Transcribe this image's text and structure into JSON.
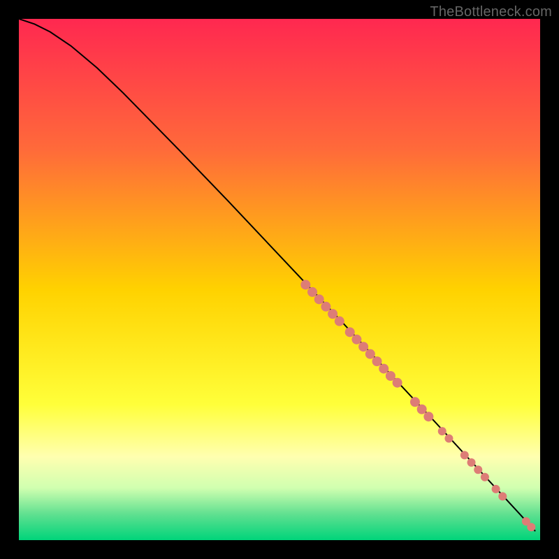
{
  "watermark": "TheBottleneck.com",
  "chart_data": {
    "type": "line",
    "title": "",
    "xlabel": "",
    "ylabel": "",
    "xlim": [
      0,
      100
    ],
    "ylim": [
      0,
      100
    ],
    "grid": false,
    "background_gradient": {
      "stops": [
        {
          "offset": 0,
          "color": "#ff2850"
        },
        {
          "offset": 25,
          "color": "#ff6a3a"
        },
        {
          "offset": 52,
          "color": "#ffd200"
        },
        {
          "offset": 74,
          "color": "#ffff3a"
        },
        {
          "offset": 84,
          "color": "#ffffb0"
        },
        {
          "offset": 90,
          "color": "#d0ffb0"
        },
        {
          "offset": 95,
          "color": "#60e090"
        },
        {
          "offset": 100,
          "color": "#00d47a"
        }
      ]
    },
    "series": [
      {
        "name": "curve",
        "type": "line",
        "color": "#000000",
        "x": [
          0,
          3,
          6,
          10,
          15,
          20,
          30,
          40,
          50,
          60,
          70,
          80,
          90,
          96,
          99
        ],
        "y": [
          100,
          99,
          97.5,
          94.8,
          90.6,
          85.8,
          75.6,
          65.2,
          54.6,
          44.0,
          33.2,
          22.5,
          11.6,
          5.1,
          1.8
        ]
      },
      {
        "name": "markers",
        "type": "scatter",
        "color": "#dd7d76",
        "points": [
          {
            "x": 55.0,
            "y": 49.0,
            "r": 7
          },
          {
            "x": 56.3,
            "y": 47.6,
            "r": 7
          },
          {
            "x": 57.6,
            "y": 46.2,
            "r": 7
          },
          {
            "x": 58.9,
            "y": 44.8,
            "r": 7
          },
          {
            "x": 60.2,
            "y": 43.4,
            "r": 7
          },
          {
            "x": 61.5,
            "y": 42.0,
            "r": 7
          },
          {
            "x": 63.5,
            "y": 39.9,
            "r": 7
          },
          {
            "x": 64.8,
            "y": 38.5,
            "r": 7
          },
          {
            "x": 66.1,
            "y": 37.1,
            "r": 7
          },
          {
            "x": 67.4,
            "y": 35.7,
            "r": 7
          },
          {
            "x": 68.7,
            "y": 34.3,
            "r": 7
          },
          {
            "x": 70.0,
            "y": 32.9,
            "r": 7
          },
          {
            "x": 71.3,
            "y": 31.5,
            "r": 7
          },
          {
            "x": 72.6,
            "y": 30.2,
            "r": 7
          },
          {
            "x": 76.0,
            "y": 26.5,
            "r": 7
          },
          {
            "x": 77.3,
            "y": 25.1,
            "r": 7
          },
          {
            "x": 78.6,
            "y": 23.7,
            "r": 7
          },
          {
            "x": 81.2,
            "y": 20.9,
            "r": 6
          },
          {
            "x": 82.5,
            "y": 19.5,
            "r": 6
          },
          {
            "x": 85.5,
            "y": 16.3,
            "r": 6
          },
          {
            "x": 86.8,
            "y": 14.9,
            "r": 6
          },
          {
            "x": 88.1,
            "y": 13.5,
            "r": 6
          },
          {
            "x": 89.4,
            "y": 12.1,
            "r": 6
          },
          {
            "x": 91.5,
            "y": 9.8,
            "r": 6
          },
          {
            "x": 92.8,
            "y": 8.4,
            "r": 6
          },
          {
            "x": 97.3,
            "y": 3.6,
            "r": 6
          },
          {
            "x": 98.3,
            "y": 2.5,
            "r": 6
          }
        ]
      }
    ]
  }
}
